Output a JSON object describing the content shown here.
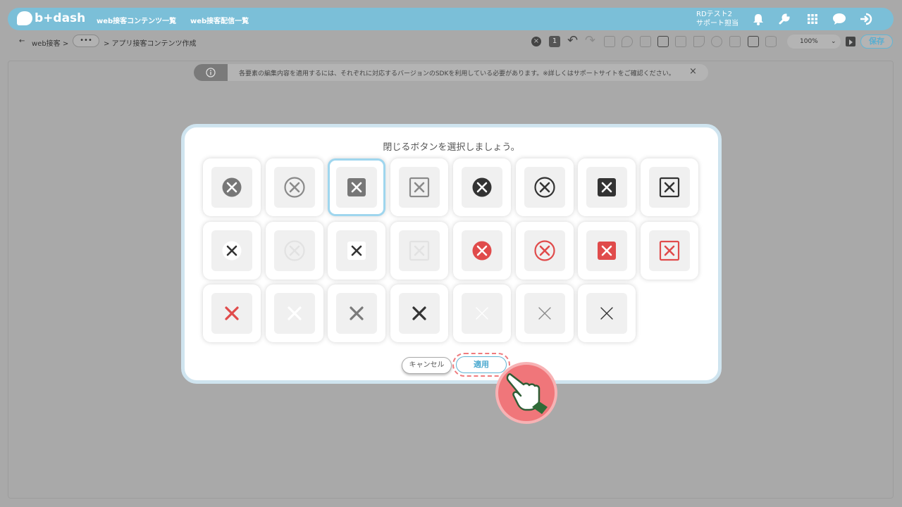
{
  "header": {
    "logo_text": "b+dash",
    "nav": [
      "web接客コンテンツ一覧",
      "web接客配信一覧"
    ],
    "user_line1": "RDテスト2",
    "user_line2": "サポート担当"
  },
  "breadcrumb": {
    "back": "←",
    "root": "web接客 >",
    "more": "•••",
    "current": "> アプリ接客コンテンツ作成"
  },
  "toolbar": {
    "badge_count": "1",
    "zoom": "100%",
    "save_label": "保存"
  },
  "notice": {
    "icon": "i",
    "text": "各要素の編集内容を適用するには、それぞれに対応するバージョンのSDKを利用している必要があります。※詳しくはサポートサイトをご確認ください。",
    "close": "×"
  },
  "modal": {
    "title": "閉じるボタンを選択しましょう。",
    "cancel_label": "キャンセル",
    "apply_label": "適用",
    "selected_index": 2,
    "options": [
      {
        "name": "gray-filled-circle",
        "shape": "circle",
        "fill": "#777777",
        "stroke": "none",
        "x": "#ffffff"
      },
      {
        "name": "gray-outline-circle",
        "shape": "circle",
        "fill": "none",
        "stroke": "#8a8a8a",
        "x": "#8a8a8a"
      },
      {
        "name": "gray-filled-square",
        "shape": "square",
        "fill": "#777777",
        "stroke": "none",
        "x": "#ffffff"
      },
      {
        "name": "gray-outline-square",
        "shape": "square",
        "fill": "none",
        "stroke": "#8a8a8a",
        "x": "#8a8a8a"
      },
      {
        "name": "dark-filled-circle",
        "shape": "circle",
        "fill": "#333333",
        "stroke": "none",
        "x": "#ffffff"
      },
      {
        "name": "dark-outline-circle",
        "shape": "circle",
        "fill": "none",
        "stroke": "#333333",
        "x": "#333333"
      },
      {
        "name": "dark-filled-square",
        "shape": "square",
        "fill": "#333333",
        "stroke": "none",
        "x": "#ffffff"
      },
      {
        "name": "dark-outline-square",
        "shape": "square",
        "fill": "none",
        "stroke": "#333333",
        "x": "#333333"
      },
      {
        "name": "white-filled-circle",
        "shape": "circle",
        "fill": "#ffffff",
        "stroke": "none",
        "x": "#333333"
      },
      {
        "name": "white-outline-circle",
        "shape": "circle",
        "fill": "none",
        "stroke": "#e2e2e2",
        "x": "#e2e2e2"
      },
      {
        "name": "white-filled-square",
        "shape": "square",
        "fill": "#ffffff",
        "stroke": "none",
        "x": "#333333"
      },
      {
        "name": "white-outline-square",
        "shape": "square",
        "fill": "none",
        "stroke": "#e2e2e2",
        "x": "#e2e2e2"
      },
      {
        "name": "red-filled-circle",
        "shape": "circle",
        "fill": "#e04b4b",
        "stroke": "none",
        "x": "#ffffff"
      },
      {
        "name": "red-outline-circle",
        "shape": "circle",
        "fill": "none",
        "stroke": "#e04b4b",
        "x": "#e04b4b"
      },
      {
        "name": "red-filled-square",
        "shape": "square",
        "fill": "#e04b4b",
        "stroke": "none",
        "x": "#ffffff"
      },
      {
        "name": "red-outline-square",
        "shape": "square",
        "fill": "none",
        "stroke": "#e04b4b",
        "x": "#e04b4b"
      },
      {
        "name": "red-bold-x",
        "shape": "x",
        "fill": "none",
        "stroke": "none",
        "x": "#e04b4b",
        "weight": "bold"
      },
      {
        "name": "white-bold-x",
        "shape": "x",
        "fill": "none",
        "stroke": "none",
        "x": "#ffffff",
        "weight": "bold"
      },
      {
        "name": "gray-bold-x",
        "shape": "x",
        "fill": "none",
        "stroke": "none",
        "x": "#7a7a7a",
        "weight": "bold"
      },
      {
        "name": "dark-bold-x",
        "shape": "x",
        "fill": "none",
        "stroke": "none",
        "x": "#333333",
        "weight": "bold"
      },
      {
        "name": "white-thin-x",
        "shape": "x",
        "fill": "none",
        "stroke": "none",
        "x": "#ffffff",
        "weight": "thin"
      },
      {
        "name": "gray-thin-x",
        "shape": "x",
        "fill": "none",
        "stroke": "none",
        "x": "#8a8a8a",
        "weight": "thin"
      },
      {
        "name": "dark-thin-x",
        "shape": "x",
        "fill": "none",
        "stroke": "none",
        "x": "#333333",
        "weight": "thin"
      }
    ]
  },
  "colors": {
    "accent": "#5fb4d4",
    "header_bg": "#7bbfd8",
    "highlight": "#ef7b7e"
  }
}
